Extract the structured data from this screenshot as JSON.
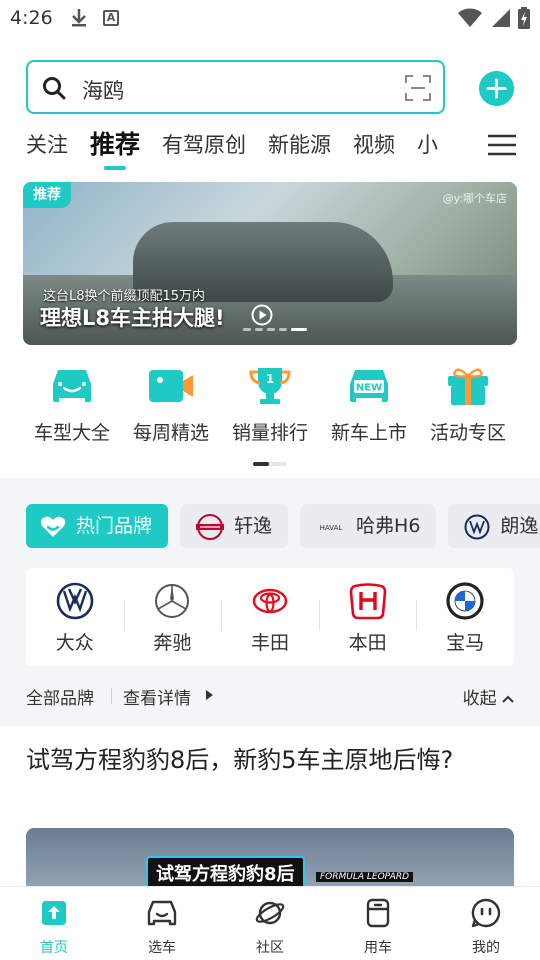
{
  "status_bar": {
    "time": "4:26"
  },
  "search": {
    "text": "海鸥"
  },
  "tabs": [
    "关注",
    "推荐",
    "有驾原创",
    "新能源",
    "视频",
    "小"
  ],
  "banner": {
    "badge": "推荐",
    "credit": "@y:哪个车店",
    "subtitle": "这台L8换个前缀顶配15万内",
    "title": "理想L8车主拍大腿!"
  },
  "quick_entries": [
    {
      "label": "车型大全",
      "icon": "car-icon"
    },
    {
      "label": "每周精选",
      "icon": "video-camera-icon"
    },
    {
      "label": "销量排行",
      "icon": "trophy-icon"
    },
    {
      "label": "新车上市",
      "icon": "new-car-icon"
    },
    {
      "label": "活动专区",
      "icon": "gift-icon"
    }
  ],
  "brand_tabs": [
    {
      "label": "热门品牌",
      "icon": "heart-icon"
    },
    {
      "label": "轩逸",
      "icon": "nissan-logo-icon"
    },
    {
      "label": "哈弗H6",
      "icon": "haval-logo-icon"
    },
    {
      "label": "朗逸",
      "icon": "volkswagen-logo-icon"
    }
  ],
  "brand_tab_logo_text": {
    "haval": "HAVAL"
  },
  "brands": [
    {
      "name": "大众",
      "icon": "volkswagen-logo-icon"
    },
    {
      "name": "奔驰",
      "icon": "mercedes-logo-icon"
    },
    {
      "name": "丰田",
      "icon": "toyota-logo-icon"
    },
    {
      "name": "本田",
      "icon": "honda-logo-icon"
    },
    {
      "name": "宝马",
      "icon": "bmw-logo-icon"
    }
  ],
  "brand_footer": {
    "all": "全部品牌",
    "detail": "查看详情",
    "collapse": "收起"
  },
  "article": {
    "title": "试驾方程豹豹8后，新豹5车主原地后悔?",
    "image_caption": "试驾方程豹豹8后",
    "image_caption_sub": "FORMULA LEOPARD"
  },
  "bottom_nav": [
    {
      "label": "首页",
      "icon": "home-icon",
      "active": true
    },
    {
      "label": "选车",
      "icon": "select-car-icon",
      "active": false
    },
    {
      "label": "社区",
      "icon": "planet-icon",
      "active": false
    },
    {
      "label": "用车",
      "icon": "phone-car-icon",
      "active": false
    },
    {
      "label": "我的",
      "icon": "profile-icon",
      "active": false
    }
  ],
  "colors": {
    "accent": "#1fc9c4",
    "section_bg": "#f4f5f7"
  }
}
